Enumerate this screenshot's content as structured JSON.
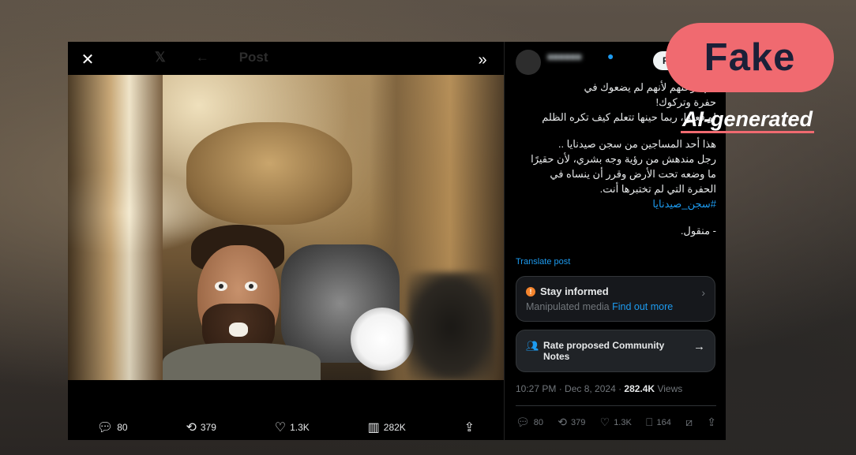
{
  "colors": {
    "badge": "#f06a70",
    "link": "#1d9bf0",
    "warning": "#f4842d"
  },
  "overlay": {
    "badge": "Fake",
    "label": "AI-generated"
  },
  "media_viewer": {
    "header_title": "Post",
    "close_icon": "close-icon",
    "expand_icon": "chevron-double-right-icon",
    "actions": {
      "replies": "80",
      "reposts": "379",
      "likes": "1.3K",
      "views": "282K"
    }
  },
  "post": {
    "follow_label": "Fo",
    "text": [
      "‫هم فرحتهم لأنهم لم يضعوك في",
      "‫حفرة وتركوك!",
      "‫لو فعلوا، ربما حينها تتعلم كيف تكره الظلم",
      "",
      "‫هذا أحد المساجين من سجن صيدنايا ..",
      "‫رجل مندهش من رؤية وجه بشري، لأن حقيرًا",
      "‫ما وضعه تحت الأرض وقرر أن ينساه في",
      "‫الحفرة التي لم تختبرها أنت."
    ],
    "hashtag": "#سجن_صيدنايا",
    "signoff": "- منقول.",
    "translate": "Translate post",
    "stay_informed": {
      "title": "Stay informed",
      "subtitle": "Manipulated media",
      "link": "Find out more"
    },
    "community_notes": {
      "title": "Rate proposed Community Notes"
    },
    "timestamp": "10:27 PM · Dec 8, 2024 · ",
    "views_count": "282.4K",
    "views_label": " Views",
    "actions": {
      "replies": "80",
      "reposts": "379",
      "likes": "1.3K",
      "bookmarks": "164"
    }
  }
}
